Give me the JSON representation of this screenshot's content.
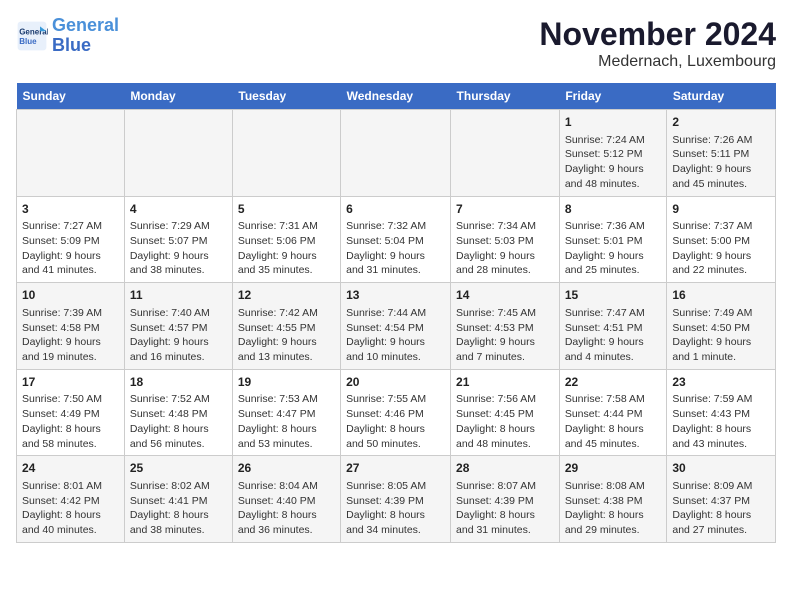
{
  "header": {
    "logo_line1": "General",
    "logo_line2": "Blue",
    "title": "November 2024",
    "subtitle": "Medernach, Luxembourg"
  },
  "weekdays": [
    "Sunday",
    "Monday",
    "Tuesday",
    "Wednesday",
    "Thursday",
    "Friday",
    "Saturday"
  ],
  "weeks": [
    [
      {
        "day": "",
        "info": ""
      },
      {
        "day": "",
        "info": ""
      },
      {
        "day": "",
        "info": ""
      },
      {
        "day": "",
        "info": ""
      },
      {
        "day": "",
        "info": ""
      },
      {
        "day": "1",
        "info": "Sunrise: 7:24 AM\nSunset: 5:12 PM\nDaylight: 9 hours and 48 minutes."
      },
      {
        "day": "2",
        "info": "Sunrise: 7:26 AM\nSunset: 5:11 PM\nDaylight: 9 hours and 45 minutes."
      }
    ],
    [
      {
        "day": "3",
        "info": "Sunrise: 7:27 AM\nSunset: 5:09 PM\nDaylight: 9 hours and 41 minutes."
      },
      {
        "day": "4",
        "info": "Sunrise: 7:29 AM\nSunset: 5:07 PM\nDaylight: 9 hours and 38 minutes."
      },
      {
        "day": "5",
        "info": "Sunrise: 7:31 AM\nSunset: 5:06 PM\nDaylight: 9 hours and 35 minutes."
      },
      {
        "day": "6",
        "info": "Sunrise: 7:32 AM\nSunset: 5:04 PM\nDaylight: 9 hours and 31 minutes."
      },
      {
        "day": "7",
        "info": "Sunrise: 7:34 AM\nSunset: 5:03 PM\nDaylight: 9 hours and 28 minutes."
      },
      {
        "day": "8",
        "info": "Sunrise: 7:36 AM\nSunset: 5:01 PM\nDaylight: 9 hours and 25 minutes."
      },
      {
        "day": "9",
        "info": "Sunrise: 7:37 AM\nSunset: 5:00 PM\nDaylight: 9 hours and 22 minutes."
      }
    ],
    [
      {
        "day": "10",
        "info": "Sunrise: 7:39 AM\nSunset: 4:58 PM\nDaylight: 9 hours and 19 minutes."
      },
      {
        "day": "11",
        "info": "Sunrise: 7:40 AM\nSunset: 4:57 PM\nDaylight: 9 hours and 16 minutes."
      },
      {
        "day": "12",
        "info": "Sunrise: 7:42 AM\nSunset: 4:55 PM\nDaylight: 9 hours and 13 minutes."
      },
      {
        "day": "13",
        "info": "Sunrise: 7:44 AM\nSunset: 4:54 PM\nDaylight: 9 hours and 10 minutes."
      },
      {
        "day": "14",
        "info": "Sunrise: 7:45 AM\nSunset: 4:53 PM\nDaylight: 9 hours and 7 minutes."
      },
      {
        "day": "15",
        "info": "Sunrise: 7:47 AM\nSunset: 4:51 PM\nDaylight: 9 hours and 4 minutes."
      },
      {
        "day": "16",
        "info": "Sunrise: 7:49 AM\nSunset: 4:50 PM\nDaylight: 9 hours and 1 minute."
      }
    ],
    [
      {
        "day": "17",
        "info": "Sunrise: 7:50 AM\nSunset: 4:49 PM\nDaylight: 8 hours and 58 minutes."
      },
      {
        "day": "18",
        "info": "Sunrise: 7:52 AM\nSunset: 4:48 PM\nDaylight: 8 hours and 56 minutes."
      },
      {
        "day": "19",
        "info": "Sunrise: 7:53 AM\nSunset: 4:47 PM\nDaylight: 8 hours and 53 minutes."
      },
      {
        "day": "20",
        "info": "Sunrise: 7:55 AM\nSunset: 4:46 PM\nDaylight: 8 hours and 50 minutes."
      },
      {
        "day": "21",
        "info": "Sunrise: 7:56 AM\nSunset: 4:45 PM\nDaylight: 8 hours and 48 minutes."
      },
      {
        "day": "22",
        "info": "Sunrise: 7:58 AM\nSunset: 4:44 PM\nDaylight: 8 hours and 45 minutes."
      },
      {
        "day": "23",
        "info": "Sunrise: 7:59 AM\nSunset: 4:43 PM\nDaylight: 8 hours and 43 minutes."
      }
    ],
    [
      {
        "day": "24",
        "info": "Sunrise: 8:01 AM\nSunset: 4:42 PM\nDaylight: 8 hours and 40 minutes."
      },
      {
        "day": "25",
        "info": "Sunrise: 8:02 AM\nSunset: 4:41 PM\nDaylight: 8 hours and 38 minutes."
      },
      {
        "day": "26",
        "info": "Sunrise: 8:04 AM\nSunset: 4:40 PM\nDaylight: 8 hours and 36 minutes."
      },
      {
        "day": "27",
        "info": "Sunrise: 8:05 AM\nSunset: 4:39 PM\nDaylight: 8 hours and 34 minutes."
      },
      {
        "day": "28",
        "info": "Sunrise: 8:07 AM\nSunset: 4:39 PM\nDaylight: 8 hours and 31 minutes."
      },
      {
        "day": "29",
        "info": "Sunrise: 8:08 AM\nSunset: 4:38 PM\nDaylight: 8 hours and 29 minutes."
      },
      {
        "day": "30",
        "info": "Sunrise: 8:09 AM\nSunset: 4:37 PM\nDaylight: 8 hours and 27 minutes."
      }
    ]
  ]
}
